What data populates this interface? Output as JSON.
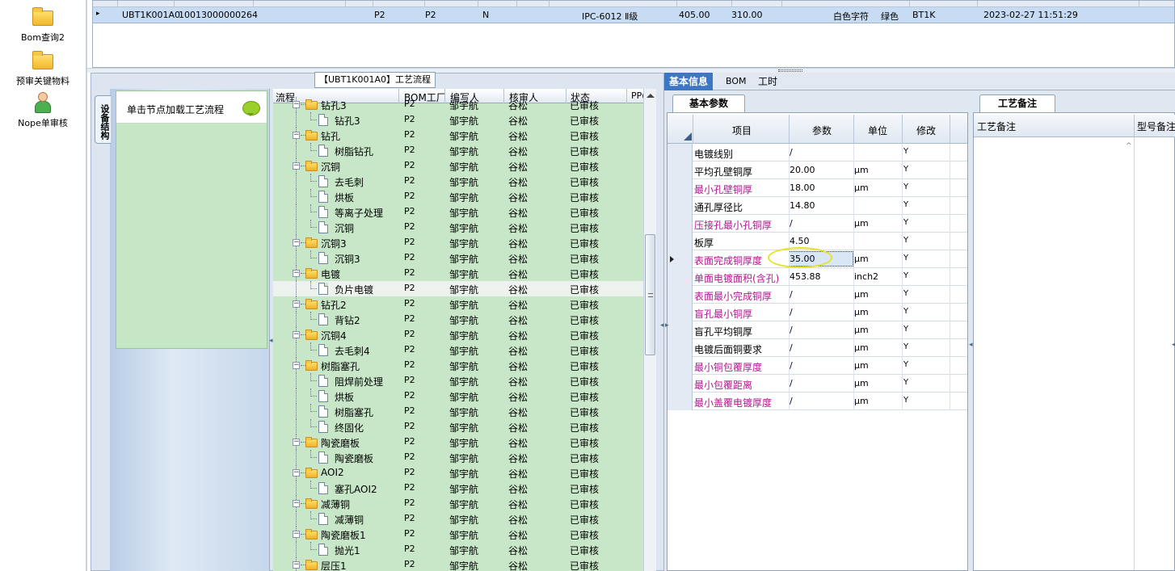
{
  "sidebar": {
    "items": [
      {
        "label": "Bom查询2",
        "icon": "folder-icon"
      },
      {
        "label": "预审关键物料",
        "icon": "folder-icon"
      },
      {
        "label": "Nope单审核",
        "icon": "user-icon"
      }
    ]
  },
  "top_grid": {
    "row": {
      "indicator": "▸",
      "code": "UBT1K001A0",
      "number": "10013000000264",
      "c1": "P2",
      "c2": "P2",
      "c3": "N",
      "material": "IPC-6012 Ⅱ级",
      "v1": "405.00",
      "v2": "310.00",
      "silkscreen": "白色字符",
      "mask": "绿色",
      "code2": "BT1K",
      "datetime": "2023-02-27 11:51:29"
    }
  },
  "flow_panel": {
    "title": "【UBT1K001A0】工艺流程",
    "vertical_tab": "设备结构",
    "node_hint": "单击节点加载工艺流程"
  },
  "tree": {
    "headers": [
      "流程",
      "BOM工厂",
      "编写人",
      "核审人",
      "状态",
      "PP("
    ],
    "rows": [
      {
        "name": "钻孔3",
        "type": "folder",
        "level": 0,
        "factory": "P2",
        "writer": "邹宇航",
        "reviewer": "谷松",
        "status": "已审核"
      },
      {
        "name": "钻孔3",
        "type": "file",
        "level": 1,
        "factory": "P2",
        "writer": "邹宇航",
        "reviewer": "谷松",
        "status": "已审核"
      },
      {
        "name": "钻孔",
        "type": "folder",
        "level": 0,
        "factory": "P2",
        "writer": "邹宇航",
        "reviewer": "谷松",
        "status": "已审核"
      },
      {
        "name": "树脂钻孔",
        "type": "file",
        "level": 1,
        "factory": "P2",
        "writer": "邹宇航",
        "reviewer": "谷松",
        "status": "已审核"
      },
      {
        "name": "沉铜",
        "type": "folder",
        "level": 0,
        "factory": "P2",
        "writer": "邹宇航",
        "reviewer": "谷松",
        "status": "已审核"
      },
      {
        "name": "去毛刺",
        "type": "file",
        "level": 1,
        "factory": "P2",
        "writer": "邹宇航",
        "reviewer": "谷松",
        "status": "已审核"
      },
      {
        "name": "烘板",
        "type": "file",
        "level": 1,
        "factory": "P2",
        "writer": "邹宇航",
        "reviewer": "谷松",
        "status": "已审核"
      },
      {
        "name": "等离子处理",
        "type": "file",
        "level": 1,
        "factory": "P2",
        "writer": "邹宇航",
        "reviewer": "谷松",
        "status": "已审核"
      },
      {
        "name": "沉铜",
        "type": "file",
        "level": 1,
        "factory": "P2",
        "writer": "邹宇航",
        "reviewer": "谷松",
        "status": "已审核"
      },
      {
        "name": "沉铜3",
        "type": "folder",
        "level": 0,
        "factory": "P2",
        "writer": "邹宇航",
        "reviewer": "谷松",
        "status": "已审核"
      },
      {
        "name": "沉铜3",
        "type": "file",
        "level": 1,
        "factory": "P2",
        "writer": "邹宇航",
        "reviewer": "谷松",
        "status": "已审核"
      },
      {
        "name": "电镀",
        "type": "folder",
        "level": 0,
        "factory": "P2",
        "writer": "邹宇航",
        "reviewer": "谷松",
        "status": "已审核"
      },
      {
        "name": "负片电镀",
        "type": "file",
        "level": 1,
        "factory": "P2",
        "writer": "邹宇航",
        "reviewer": "谷松",
        "status": "已审核",
        "selected": true
      },
      {
        "name": "钻孔2",
        "type": "folder",
        "level": 0,
        "factory": "P2",
        "writer": "邹宇航",
        "reviewer": "谷松",
        "status": "已审核"
      },
      {
        "name": "背钻2",
        "type": "file",
        "level": 1,
        "factory": "P2",
        "writer": "邹宇航",
        "reviewer": "谷松",
        "status": "已审核"
      },
      {
        "name": "沉铜4",
        "type": "folder",
        "level": 0,
        "factory": "P2",
        "writer": "邹宇航",
        "reviewer": "谷松",
        "status": "已审核"
      },
      {
        "name": "去毛刺4",
        "type": "file",
        "level": 1,
        "factory": "P2",
        "writer": "邹宇航",
        "reviewer": "谷松",
        "status": "已审核"
      },
      {
        "name": "树脂塞孔",
        "type": "folder",
        "level": 0,
        "factory": "P2",
        "writer": "邹宇航",
        "reviewer": "谷松",
        "status": "已审核"
      },
      {
        "name": "阻焊前处理",
        "type": "file",
        "level": 1,
        "factory": "P2",
        "writer": "邹宇航",
        "reviewer": "谷松",
        "status": "已审核"
      },
      {
        "name": "烘板",
        "type": "file",
        "level": 1,
        "factory": "P2",
        "writer": "邹宇航",
        "reviewer": "谷松",
        "status": "已审核"
      },
      {
        "name": "树脂塞孔",
        "type": "file",
        "level": 1,
        "factory": "P2",
        "writer": "邹宇航",
        "reviewer": "谷松",
        "status": "已审核"
      },
      {
        "name": "终固化",
        "type": "file",
        "level": 1,
        "factory": "P2",
        "writer": "邹宇航",
        "reviewer": "谷松",
        "status": "已审核"
      },
      {
        "name": "陶瓷磨板",
        "type": "folder",
        "level": 0,
        "factory": "P2",
        "writer": "邹宇航",
        "reviewer": "谷松",
        "status": "已审核"
      },
      {
        "name": "陶瓷磨板",
        "type": "file",
        "level": 1,
        "factory": "P2",
        "writer": "邹宇航",
        "reviewer": "谷松",
        "status": "已审核"
      },
      {
        "name": "AOI2",
        "type": "folder",
        "level": 0,
        "factory": "P2",
        "writer": "邹宇航",
        "reviewer": "谷松",
        "status": "已审核"
      },
      {
        "name": "塞孔AOI2",
        "type": "file",
        "level": 1,
        "factory": "P2",
        "writer": "邹宇航",
        "reviewer": "谷松",
        "status": "已审核"
      },
      {
        "name": "减薄铜",
        "type": "folder",
        "level": 0,
        "factory": "P2",
        "writer": "邹宇航",
        "reviewer": "谷松",
        "status": "已审核"
      },
      {
        "name": "减薄铜",
        "type": "file",
        "level": 1,
        "factory": "P2",
        "writer": "邹宇航",
        "reviewer": "谷松",
        "status": "已审核"
      },
      {
        "name": "陶瓷磨板1",
        "type": "folder",
        "level": 0,
        "factory": "P2",
        "writer": "邹宇航",
        "reviewer": "谷松",
        "status": "已审核"
      },
      {
        "name": "抛光1",
        "type": "file",
        "level": 1,
        "factory": "P2",
        "writer": "邹宇航",
        "reviewer": "谷松",
        "status": "已审核"
      },
      {
        "name": "层压1",
        "type": "folder",
        "level": 0,
        "factory": "P2",
        "writer": "邹宇航",
        "reviewer": "谷松",
        "status": "已审核"
      }
    ]
  },
  "right": {
    "tabs": [
      {
        "label": "基本信息",
        "active": true
      },
      {
        "label": "BOM",
        "active": false
      },
      {
        "label": "工时",
        "active": false
      }
    ],
    "basic_tab": "基本参数",
    "note_tab": "工艺备注",
    "param_headers": [
      "项目",
      "参数",
      "单位",
      "修改"
    ],
    "params": [
      {
        "name": "电镀线别",
        "value": "/",
        "unit": "",
        "mod": "Y",
        "pink": false
      },
      {
        "name": "平均孔壁铜厚",
        "value": "20.00",
        "unit": "μm",
        "mod": "Y",
        "pink": false
      },
      {
        "name": "最小孔壁铜厚",
        "value": "18.00",
        "unit": "μm",
        "mod": "Y",
        "pink": true
      },
      {
        "name": "通孔厚径比",
        "value": "14.80",
        "unit": "",
        "mod": "Y",
        "pink": false
      },
      {
        "name": "压接孔最小孔铜厚",
        "value": "/",
        "unit": "μm",
        "mod": "Y",
        "pink": true
      },
      {
        "name": "板厚",
        "value": "4.50",
        "unit": "",
        "mod": "Y",
        "pink": false
      },
      {
        "name": "表面完成铜厚度",
        "value": "35.00",
        "unit": "μm",
        "mod": "Y",
        "pink": true,
        "current": true
      },
      {
        "name": "单面电镀面积(含孔)",
        "value": "453.88",
        "unit": "inch2",
        "mod": "Y",
        "pink": true
      },
      {
        "name": "表面最小完成铜厚",
        "value": "/",
        "unit": "μm",
        "mod": "Y",
        "pink": true
      },
      {
        "name": "盲孔最小铜厚",
        "value": "/",
        "unit": "μm",
        "mod": "Y",
        "pink": true
      },
      {
        "name": "盲孔平均铜厚",
        "value": "/",
        "unit": "μm",
        "mod": "Y",
        "pink": false
      },
      {
        "name": "电镀后面铜要求",
        "value": "/",
        "unit": "μm",
        "mod": "Y",
        "pink": false
      },
      {
        "name": "最小铜包覆厚度",
        "value": "/",
        "unit": "μm",
        "mod": "Y",
        "pink": true
      },
      {
        "name": "最小包覆距离",
        "value": "/",
        "unit": "μm",
        "mod": "Y",
        "pink": true
      },
      {
        "name": "最小盖覆电镀厚度",
        "value": "/",
        "unit": "μm",
        "mod": "Y",
        "pink": true
      }
    ],
    "note_headers": [
      "工艺备注",
      "型号备注"
    ]
  },
  "colors": {
    "tree_bg": "#c8e7c8",
    "active_tab": "#3d77c4",
    "pink_label": "#b0188f",
    "highlight_ellipse": "#e8e227"
  }
}
